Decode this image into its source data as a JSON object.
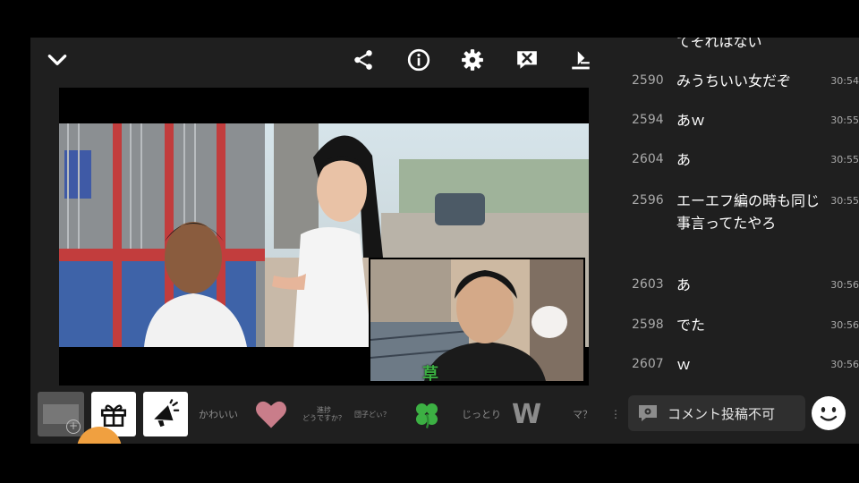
{
  "toolbar": {
    "icons": [
      "chevron-down-icon",
      "share-icon",
      "info-icon",
      "gear-icon",
      "comment-off-icon",
      "download-icon"
    ]
  },
  "video": {
    "pip_caption": "草"
  },
  "gifts": {
    "gift_label_1": "かわいい",
    "gift_label_2_line1": "進捗",
    "gift_label_2_line2": "どうですか？",
    "gift_label_3": "団子どぃ？",
    "gift_label_4": "じっとり",
    "gift_label_5": "W",
    "gift_label_6": "マ？"
  },
  "comments": [
    {
      "num": "",
      "text": "てそれはない",
      "time": ""
    },
    {
      "num": "2590",
      "text": "みうちいい女だぞ",
      "time": "30:54"
    },
    {
      "num": "2594",
      "text": "あｗ",
      "time": "30:55"
    },
    {
      "num": "2604",
      "text": "あ",
      "time": "30:55"
    },
    {
      "num": "2596",
      "text": "エーエフ編の時も同じ事言ってたやろ",
      "time": "30:55"
    },
    {
      "num": "2603",
      "text": "あ",
      "time": "30:56"
    },
    {
      "num": "2598",
      "text": "でた",
      "time": "30:56"
    },
    {
      "num": "2607",
      "text": "ｗ",
      "time": "30:56"
    }
  ],
  "post": {
    "label": "コメント投稿不可"
  },
  "colors": {
    "panel": "#1f1f1f",
    "heart": "#c97d8a",
    "clover": "#3cb043",
    "accent_orange": "#f0a040"
  }
}
